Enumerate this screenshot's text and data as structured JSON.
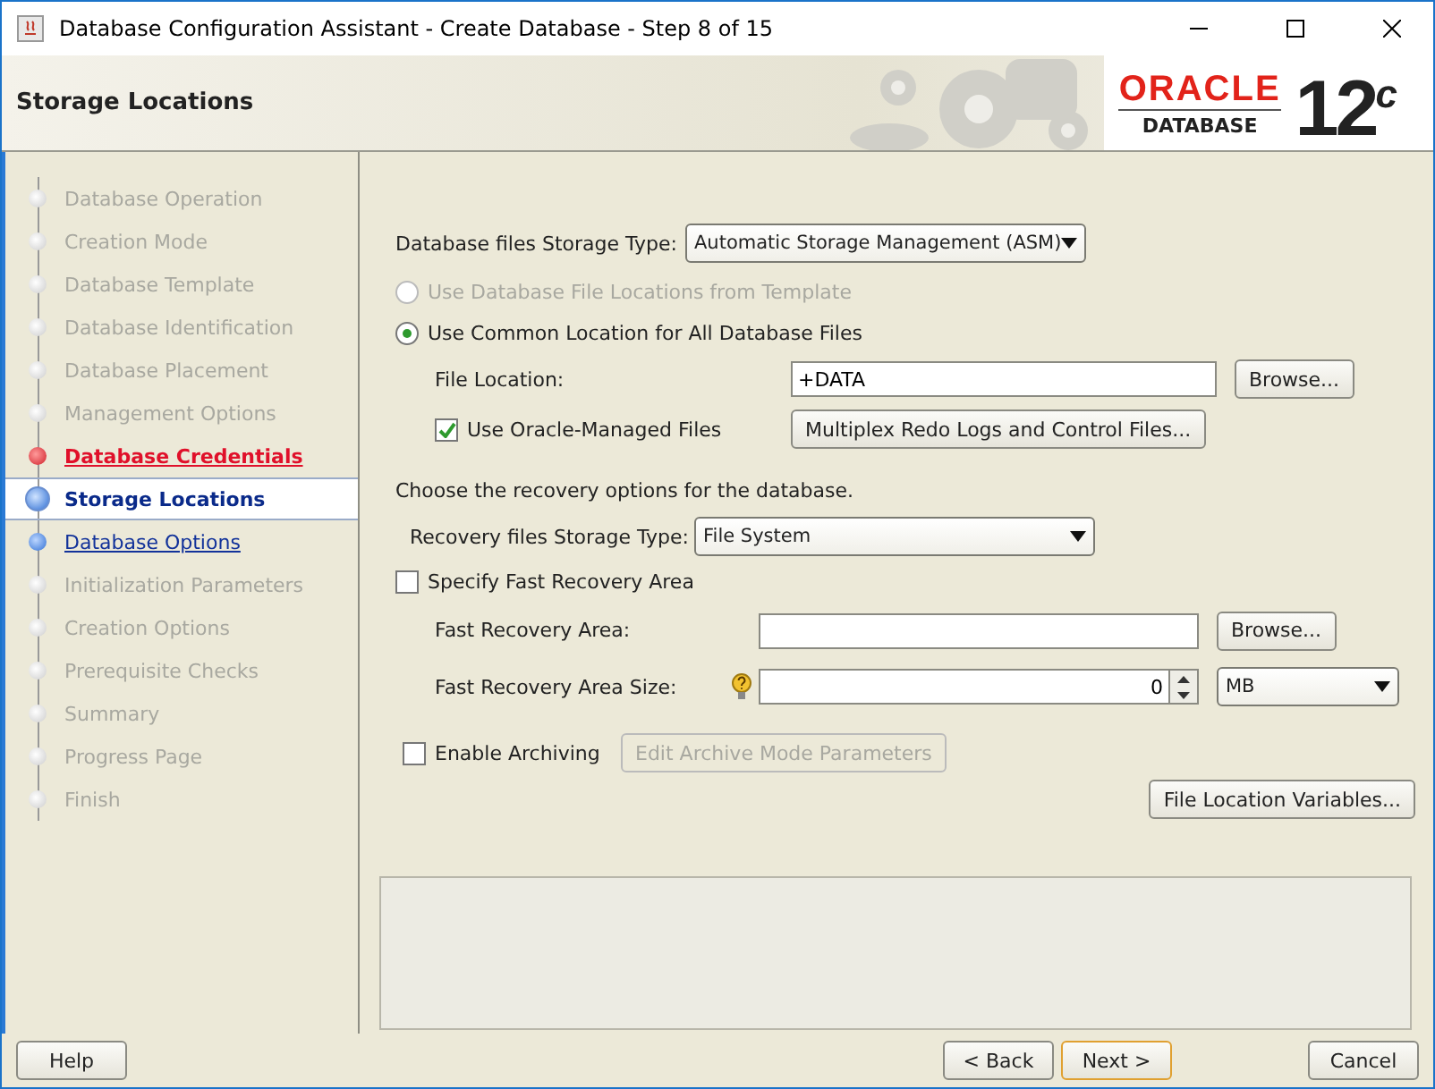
{
  "window": {
    "title": "Database Configuration Assistant - Create Database - Step 8 of 15"
  },
  "header": {
    "title": "Storage Locations",
    "logo": {
      "brand": "ORACLE",
      "product": "DATABASE",
      "version": "12",
      "version_suffix": "c"
    }
  },
  "steps": [
    {
      "label": "Database Operation",
      "kind": "pending"
    },
    {
      "label": "Creation Mode",
      "kind": "pending"
    },
    {
      "label": "Database Template",
      "kind": "pending"
    },
    {
      "label": "Database Identification",
      "kind": "pending"
    },
    {
      "label": "Database Placement",
      "kind": "pending"
    },
    {
      "label": "Management Options",
      "kind": "pending"
    },
    {
      "label": "Database Credentials",
      "kind": "error"
    },
    {
      "label": "Storage Locations",
      "kind": "current"
    },
    {
      "label": "Database Options",
      "kind": "link"
    },
    {
      "label": "Initialization Parameters",
      "kind": "pending"
    },
    {
      "label": "Creation Options",
      "kind": "pending"
    },
    {
      "label": "Prerequisite Checks",
      "kind": "pending"
    },
    {
      "label": "Summary",
      "kind": "pending"
    },
    {
      "label": "Progress Page",
      "kind": "pending"
    },
    {
      "label": "Finish",
      "kind": "pending"
    }
  ],
  "storage": {
    "label": "Database files Storage Type:",
    "value": "Automatic Storage Management (ASM)"
  },
  "location_options": [
    {
      "label": "Use Database File Locations from Template",
      "selected": false,
      "disabled": true
    },
    {
      "label": "Use Common Location for All Database Files",
      "selected": true,
      "disabled": false
    }
  ],
  "file_location": {
    "label": "File Location:",
    "value": "+DATA",
    "browse": "Browse..."
  },
  "oracle_managed": {
    "label": "Use Oracle-Managed Files",
    "checked": true,
    "button": "Multiplex Redo Logs and Control Files..."
  },
  "recovery_intro": "Choose the recovery options for the database.",
  "recovery_type": {
    "label": "Recovery files Storage Type:",
    "value": "File System"
  },
  "fast_recovery": {
    "label": "Specify Fast Recovery Area",
    "checked": false
  },
  "fra_location": {
    "label": "Fast Recovery Area:",
    "browse": "Browse..."
  },
  "fra_size": {
    "label": "Fast Recovery Area Size:",
    "value": "0",
    "unit": "MB"
  },
  "archiving": {
    "label": "Enable Archiving",
    "checked": false,
    "button": "Edit Archive Mode Parameters",
    "button_disabled": true
  },
  "variables_button": "File Location Variables...",
  "footer": {
    "help": "Help",
    "back": "< Back",
    "next": "Next >",
    "cancel": "Cancel"
  }
}
